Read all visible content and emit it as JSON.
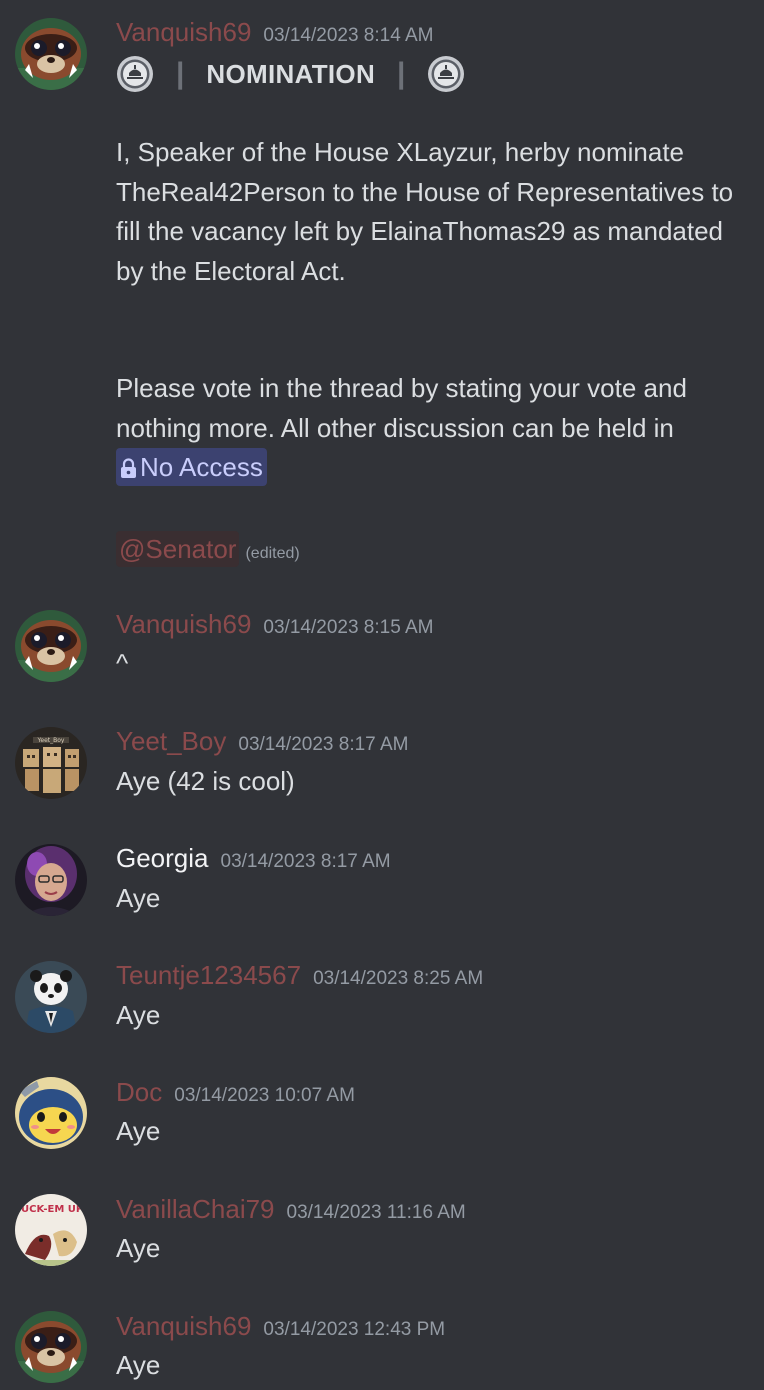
{
  "messages": [
    {
      "author": "Vanquish69",
      "timestamp": "03/14/2023 8:14 AM",
      "nomination_title": "NOMINATION",
      "separator": "|",
      "paragraph1": "I, Speaker of the House XLayzur, herby nominate TheReal42Person to the House of Representatives to fill the vacancy left by ElainaThomas29 as mandated by the Electoral Act.",
      "paragraph2": "Please vote in the thread by stating your vote and nothing more. All other discussion can be held in",
      "channel_mention": "No Access",
      "role_mention": "@Senator",
      "edited_label": "(edited)"
    },
    {
      "author": "Vanquish69",
      "timestamp": "03/14/2023 8:15 AM",
      "text": "^"
    },
    {
      "author": "Yeet_Boy",
      "timestamp": "03/14/2023 8:17 AM",
      "text": "Aye (42 is cool)",
      "avatar_text": "Yeet_Boy"
    },
    {
      "author": "Georgia",
      "timestamp": "03/14/2023 8:17 AM",
      "text": "Aye"
    },
    {
      "author": "Teuntje1234567",
      "timestamp": "03/14/2023 8:25 AM",
      "text": "Aye"
    },
    {
      "author": "Doc",
      "timestamp": "03/14/2023 10:07 AM",
      "text": "Aye"
    },
    {
      "author": "VanillaChai79",
      "timestamp": "03/14/2023 11:16 AM",
      "text": "Aye",
      "avatar_text": "FUCK-EM UP!"
    },
    {
      "author": "Vanquish69",
      "timestamp": "03/14/2023 12:43 PM",
      "text": "Aye"
    }
  ],
  "colors": {
    "background": "#313338",
    "role_name": "#8b4a4c",
    "timestamp": "#949ba4",
    "message_text": "#dbdee1",
    "channel_mention_bg": "#3c4270"
  },
  "icons": {
    "seal": "seal-emoji-icon",
    "lock": "lock-icon"
  }
}
